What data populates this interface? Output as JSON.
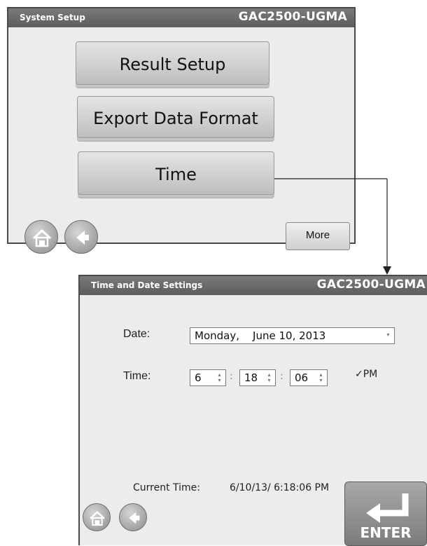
{
  "screen1": {
    "title": "System Setup",
    "device": "GAC2500-UGMA",
    "buttons": [
      "Result Setup",
      "Export Data Format",
      "Time"
    ],
    "more_label": "More",
    "home_icon": "home-icon",
    "back_icon": "back-arrow-icon"
  },
  "screen2": {
    "title": "Time and Date Settings",
    "device": "GAC2500-UGMA",
    "date_label": "Date:",
    "date_value": "Monday,    June 10, 2013",
    "time_label": "Time:",
    "hour": "6",
    "minute": "18",
    "second": "06",
    "separator": ":",
    "ampm": "PM",
    "ampm_checked": true,
    "current_time_label": "Current Time:",
    "current_time_value": "6/10/13/ 6:18:06 PM",
    "enter_label": "ENTER"
  }
}
